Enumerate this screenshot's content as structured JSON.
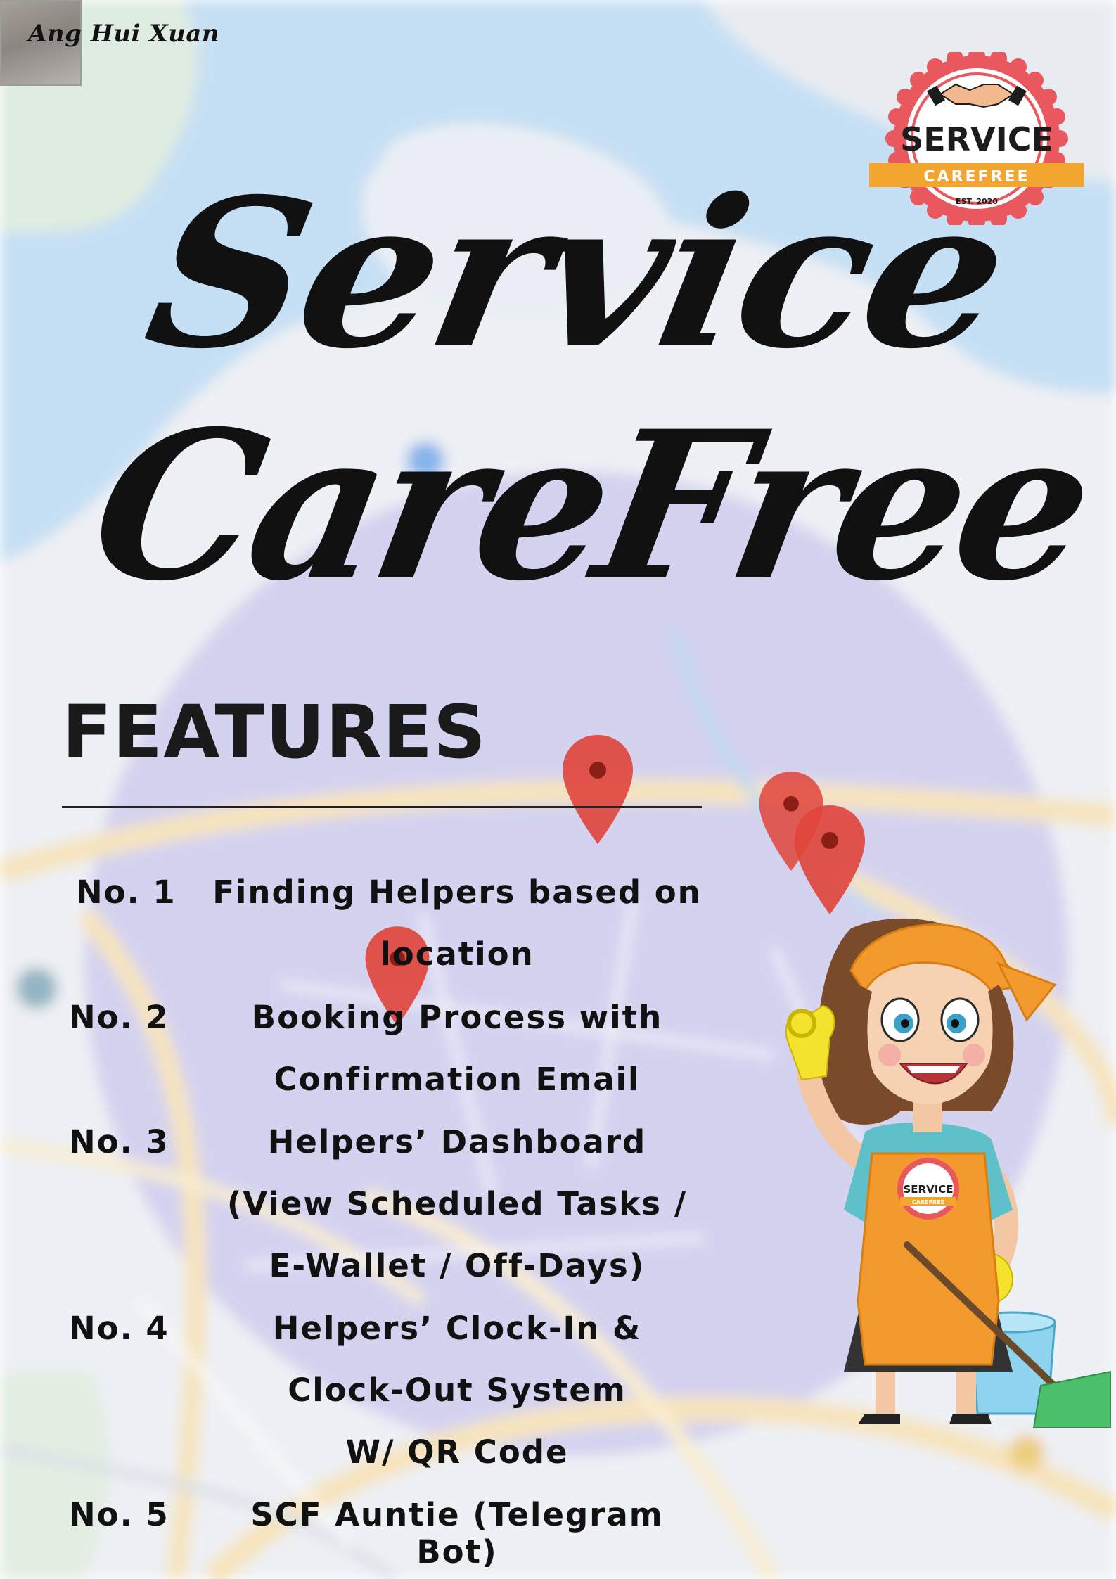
{
  "author": "Ang Hui Xuan",
  "title": {
    "line1": "Service",
    "line2": "CareFree"
  },
  "logo": {
    "word1": "SERVICE",
    "word2": "CAREFREE",
    "est": "EST. 2020",
    "colors": {
      "ring": "#e9585f",
      "banner": "#f3a62f",
      "text": "#1c1c1c"
    }
  },
  "features_heading": "FEATURES",
  "features": [
    {
      "num": "No. 1",
      "lines": [
        "Finding Helpers based on",
        "location"
      ]
    },
    {
      "num": "No. 2",
      "lines": [
        "Booking Process with",
        "Confirmation Email"
      ]
    },
    {
      "num": "No. 3",
      "lines": [
        "Helpers’ Dashboard",
        "(View Scheduled Tasks /",
        "E-Wallet  / Off-Days)"
      ]
    },
    {
      "num": "No. 4",
      "lines": [
        "Helpers’ Clock-In &",
        "Clock-Out System",
        "W/ QR Code"
      ]
    },
    {
      "num": "No. 5",
      "lines": [
        "SCF Auntie (Telegram Bot)"
      ]
    }
  ],
  "mascot": {
    "apron_badge_word1": "SERVICE",
    "apron_badge_word2": "CAREFREE"
  },
  "colors": {
    "map_water": "#a9d0ee",
    "map_land": "#e6eaf1",
    "map_circle": "#b9b7e6",
    "map_road": "#f3d9a0",
    "pin": "#e0443a"
  }
}
